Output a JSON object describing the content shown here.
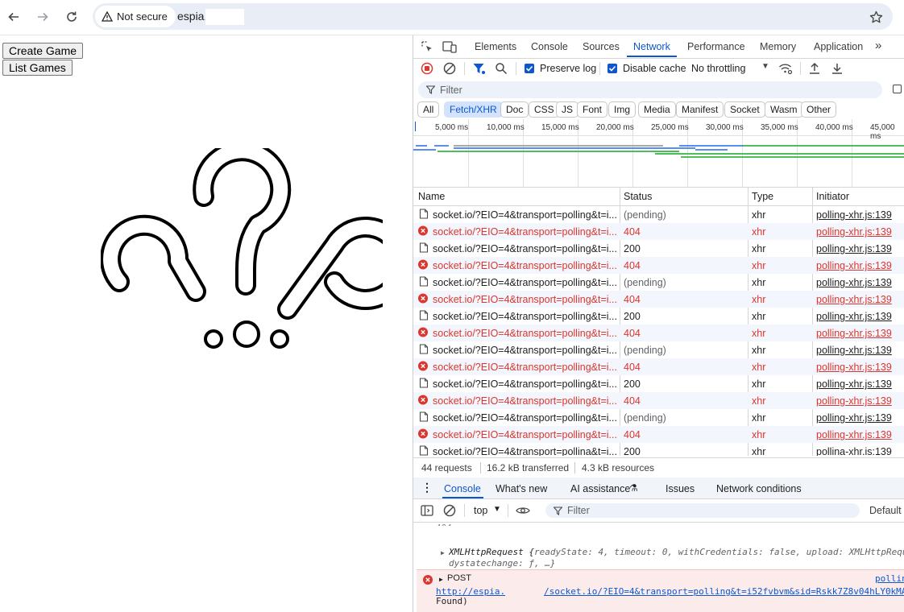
{
  "browser": {
    "security_label": "Not secure",
    "url": "espia."
  },
  "page": {
    "buttons": [
      "Create Game",
      "List Games"
    ]
  },
  "devtools": {
    "tabs": [
      "Elements",
      "Console",
      "Sources",
      "Network",
      "Performance",
      "Memory",
      "Application"
    ],
    "active_tab": "Network",
    "toolbar": {
      "preserve_log_label": "Preserve log",
      "preserve_log_checked": true,
      "disable_cache_label": "Disable cache",
      "disable_cache_checked": true,
      "throttling": "No throttling"
    },
    "filter_placeholder": "Filter",
    "type_filters": [
      "All",
      "Fetch/XHR",
      "Doc",
      "CSS",
      "JS",
      "Font",
      "Img",
      "Media",
      "Manifest",
      "Socket",
      "Wasm",
      "Other"
    ],
    "active_type_filter": "Fetch/XHR",
    "timeline_ticks": [
      "5,000 ms",
      "10,000 ms",
      "15,000 ms",
      "20,000 ms",
      "25,000 ms",
      "30,000 ms",
      "35,000 ms",
      "40,000 ms",
      "45,000 ms"
    ],
    "columns": [
      "Name",
      "Status",
      "Type",
      "Initiator"
    ],
    "requests": [
      {
        "name": "socket.io/?EIO=4&transport=polling&t=i...",
        "status": "(pending)",
        "type": "xhr",
        "initiator": "polling-xhr.js:139",
        "error": false
      },
      {
        "name": "socket.io/?EIO=4&transport=polling&t=i...",
        "status": "404",
        "type": "xhr",
        "initiator": "polling-xhr.js:139",
        "error": true
      },
      {
        "name": "socket.io/?EIO=4&transport=polling&t=i...",
        "status": "200",
        "type": "xhr",
        "initiator": "polling-xhr.js:139",
        "error": false
      },
      {
        "name": "socket.io/?EIO=4&transport=polling&t=i...",
        "status": "404",
        "type": "xhr",
        "initiator": "polling-xhr.js:139",
        "error": true
      },
      {
        "name": "socket.io/?EIO=4&transport=polling&t=i...",
        "status": "(pending)",
        "type": "xhr",
        "initiator": "polling-xhr.js:139",
        "error": false
      },
      {
        "name": "socket.io/?EIO=4&transport=polling&t=i...",
        "status": "404",
        "type": "xhr",
        "initiator": "polling-xhr.js:139",
        "error": true
      },
      {
        "name": "socket.io/?EIO=4&transport=polling&t=i...",
        "status": "200",
        "type": "xhr",
        "initiator": "polling-xhr.js:139",
        "error": false
      },
      {
        "name": "socket.io/?EIO=4&transport=polling&t=i...",
        "status": "404",
        "type": "xhr",
        "initiator": "polling-xhr.js:139",
        "error": true
      },
      {
        "name": "socket.io/?EIO=4&transport=polling&t=i...",
        "status": "(pending)",
        "type": "xhr",
        "initiator": "polling-xhr.js:139",
        "error": false
      },
      {
        "name": "socket.io/?EIO=4&transport=polling&t=i...",
        "status": "404",
        "type": "xhr",
        "initiator": "polling-xhr.js:139",
        "error": true
      },
      {
        "name": "socket.io/?EIO=4&transport=polling&t=i...",
        "status": "200",
        "type": "xhr",
        "initiator": "polling-xhr.js:139",
        "error": false
      },
      {
        "name": "socket.io/?EIO=4&transport=polling&t=i...",
        "status": "404",
        "type": "xhr",
        "initiator": "polling-xhr.js:139",
        "error": true
      },
      {
        "name": "socket.io/?EIO=4&transport=polling&t=i...",
        "status": "(pending)",
        "type": "xhr",
        "initiator": "polling-xhr.js:139",
        "error": false
      },
      {
        "name": "socket.io/?EIO=4&transport=polling&t=i...",
        "status": "404",
        "type": "xhr",
        "initiator": "polling-xhr.js:139",
        "error": true
      },
      {
        "name": "socket.io/?EIO=4&transport=pollina&t=i...",
        "status": "200",
        "type": "xhr",
        "initiator": "pollina-xhr.is:139",
        "error": false
      }
    ],
    "summary": {
      "requests": "44 requests",
      "transferred": "16.2 kB transferred",
      "resources": "4.3 kB resources"
    },
    "drawer_tabs": [
      "Console",
      "What's new",
      "AI assistance",
      "Issues",
      "Network conditions"
    ],
    "active_drawer_tab": "Console",
    "console_toolbar": {
      "context": "top",
      "filter_placeholder": "Filter",
      "levels": "Default"
    },
    "console_messages": {
      "object_line1_head": "XMLHttpRequest {",
      "object_line1_body": "readyState: 4, timeout: 0, withCredentials: false, upload: XMLHttpRequ",
      "object_line2": "dystatechange: ƒ, …}",
      "error_method": "POST",
      "error_source": "pollin",
      "error_url_start": "http://espia.",
      "error_url_end": "/socket.io/?EIO=4&transport=polling&t=i52fvbvm&sid=Rskk7Z8v04hLY0kMA",
      "error_tail": "Found)"
    }
  },
  "colors": {
    "accent": "#0b57d0",
    "error": "#dc362e"
  }
}
